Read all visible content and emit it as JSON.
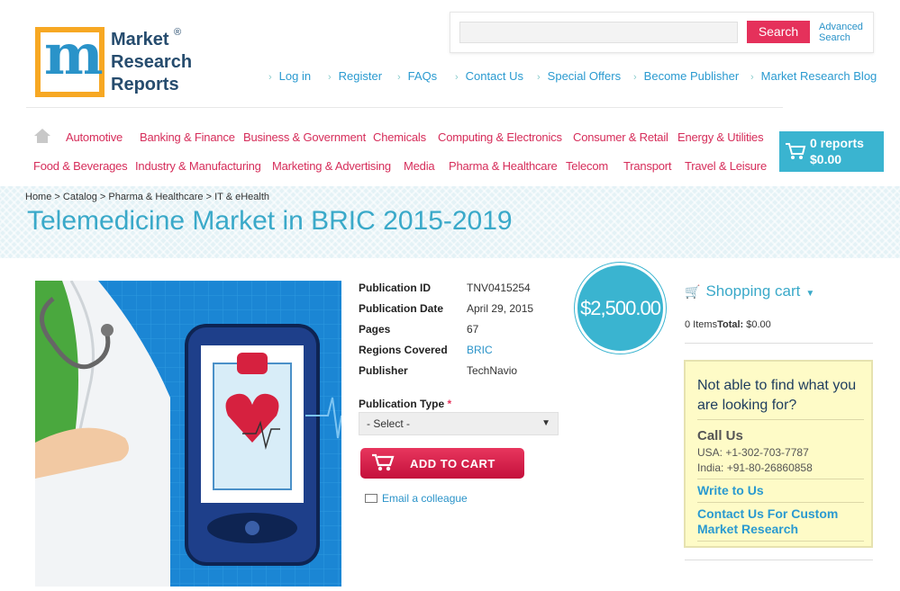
{
  "logo": {
    "lines": [
      "Market",
      "Research",
      "Reports"
    ],
    "reg": "®"
  },
  "search": {
    "button": "Search",
    "advanced": [
      "Advanced",
      "Search"
    ]
  },
  "top_links": [
    "Log in",
    "Register",
    "FAQs",
    "Contact Us",
    "Special Offers",
    "Become Publisher",
    "Market Research Blog"
  ],
  "categories_row1": [
    "Automotive",
    "Banking & Finance",
    "Business & Government",
    "Chemicals",
    "Computing & Electronics",
    "Consumer & Retail",
    "Energy & Utilities"
  ],
  "categories_row2": [
    "Food & Beverages",
    "Industry & Manufacturing",
    "Marketing & Advertising",
    "Media",
    "Pharma & Healthcare",
    "Telecom",
    "Transport",
    "Travel & Leisure"
  ],
  "cart_top": {
    "reports": "0 reports",
    "amount": "$0.00"
  },
  "breadcrumb": [
    "Home",
    "Catalog",
    "Pharma & Healthcare",
    "IT & eHealth"
  ],
  "page_title": "Telemedicine Market in BRIC 2015-2019",
  "details": [
    {
      "label": "Publication ID",
      "value": "TNV0415254"
    },
    {
      "label": "Publication Date",
      "value": "April 29, 2015"
    },
    {
      "label": "Pages",
      "value": "67"
    },
    {
      "label": "Regions Covered",
      "value": "BRIC"
    },
    {
      "label": "Publisher",
      "value": "TechNavio"
    }
  ],
  "publication_type": {
    "label": "Publication Type",
    "required": "*",
    "selected": "- Select -"
  },
  "add_to_cart": "ADD TO CART",
  "email_colleague": "Email a colleague",
  "price": "$2,500.00",
  "shopping_cart": {
    "title": "Shopping cart",
    "items": "0 Items",
    "total_label": "Total:",
    "total": "$0.00"
  },
  "help": {
    "question": "Not able to find what you are looking for?",
    "call_us": "Call Us",
    "usa": "USA: +1-302-703-7787",
    "india": "India: +91-80-26860858",
    "write": "Write to Us",
    "custom": "Contact Us For Custom Market Research"
  },
  "colors": {
    "accent": "#3ab4d0",
    "pink": "#d62d5a",
    "link": "#2a93c9"
  },
  "icons": [
    "home-icon",
    "cart-icon",
    "envelope-icon",
    "chevron-down-icon"
  ]
}
